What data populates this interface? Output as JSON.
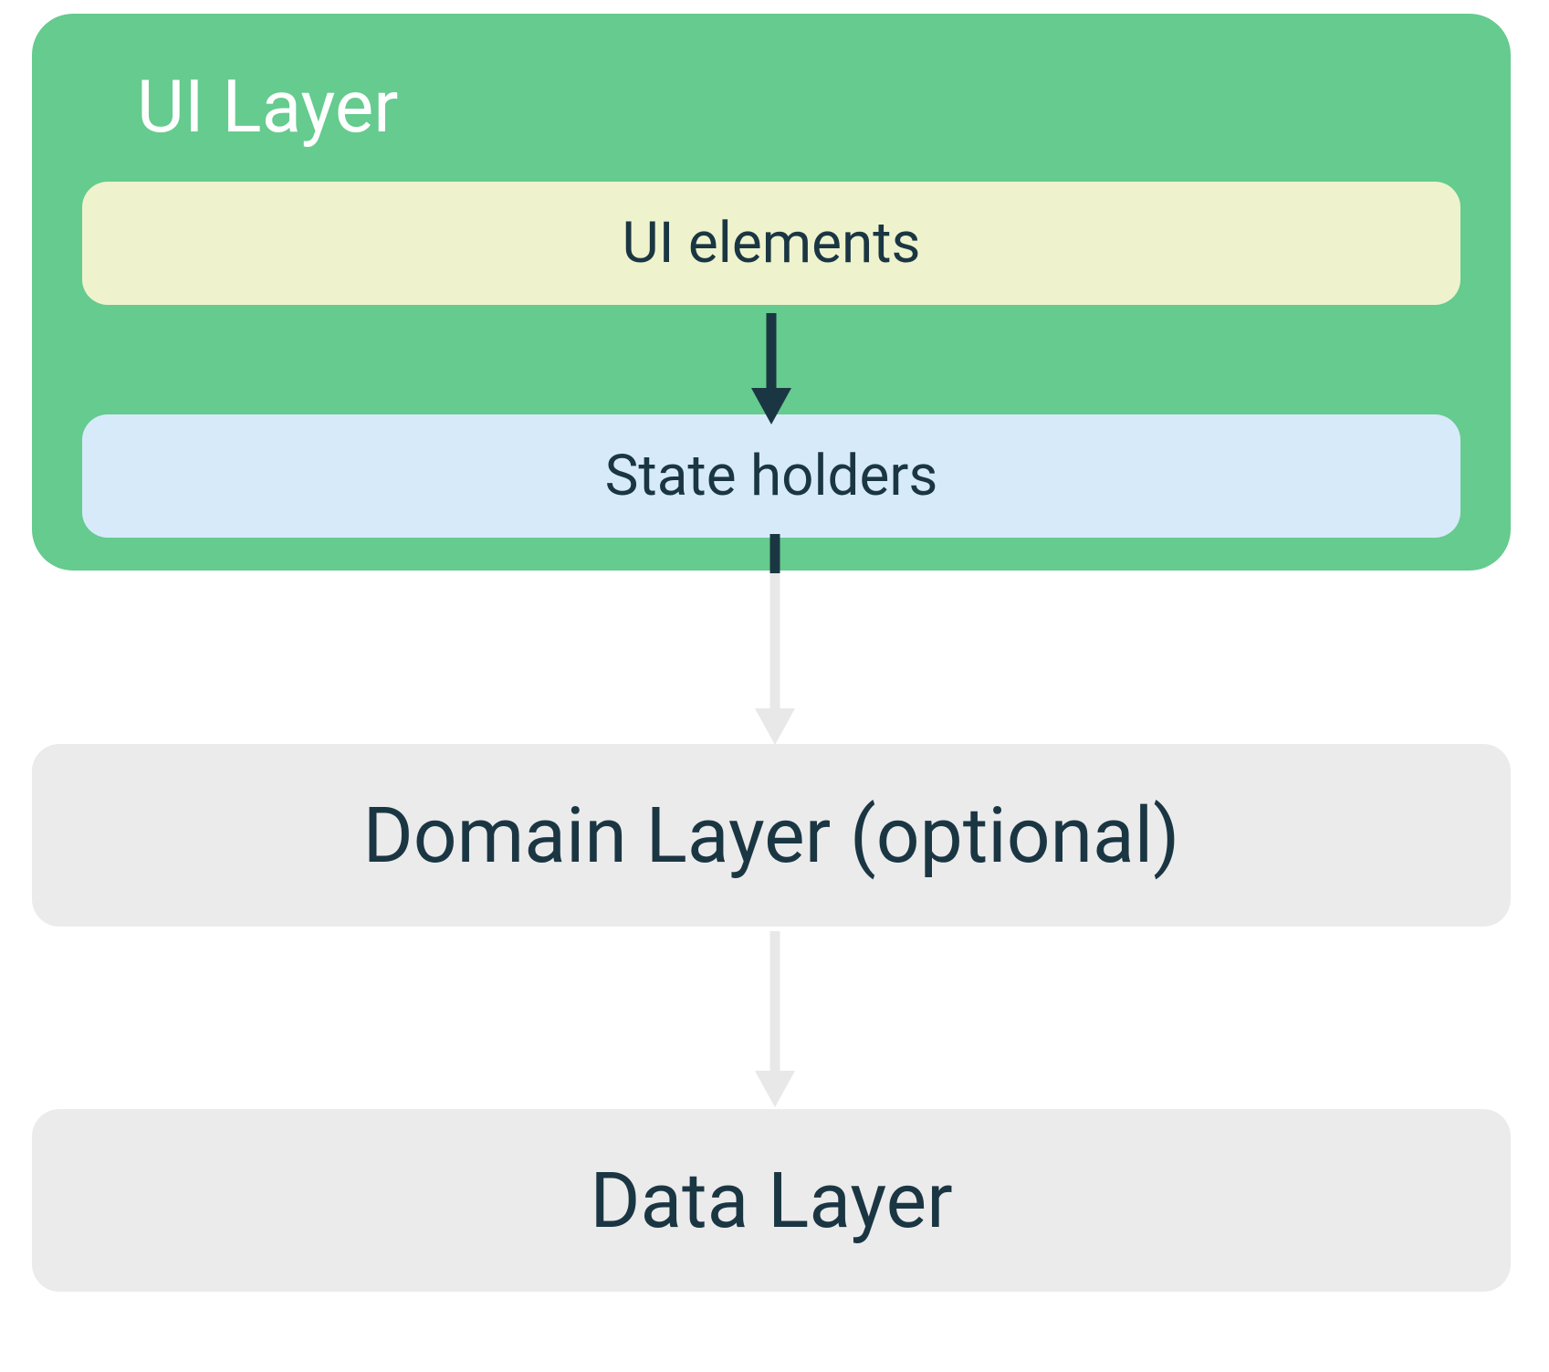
{
  "ui_layer": {
    "title": "UI Layer",
    "ui_elements_label": "UI elements",
    "state_holders_label": "State holders"
  },
  "domain_layer": {
    "label": "Domain Layer (optional)"
  },
  "data_layer": {
    "label": "Data Layer"
  },
  "colors": {
    "ui_layer_bg": "#65cb8e",
    "ui_elements_bg": "#eef3cd",
    "state_holders_bg": "#d7eafa",
    "layer_box_bg": "#ebebeb",
    "text_dark": "#1b3643",
    "text_light": "#ffffff",
    "arrow_dark": "#1b3643",
    "arrow_light": "#e8e8e8"
  }
}
